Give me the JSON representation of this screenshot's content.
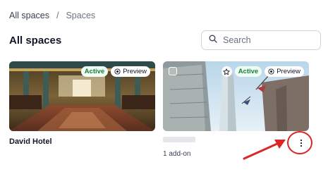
{
  "breadcrumb": {
    "root": "All spaces",
    "separator": "/",
    "current": "Spaces"
  },
  "page": {
    "title": "All spaces"
  },
  "search": {
    "placeholder": "Search",
    "icon": "search-icon"
  },
  "cards": [
    {
      "name": "David Hotel",
      "badges": {
        "active": "Active",
        "preview": "Preview"
      }
    },
    {
      "name": "",
      "addon": "1 add-on",
      "badges": {
        "active": "Active",
        "preview": "Preview",
        "star": "star-icon"
      }
    }
  ],
  "colors": {
    "active_text": "#15803d",
    "highlight": "#dc2626"
  }
}
